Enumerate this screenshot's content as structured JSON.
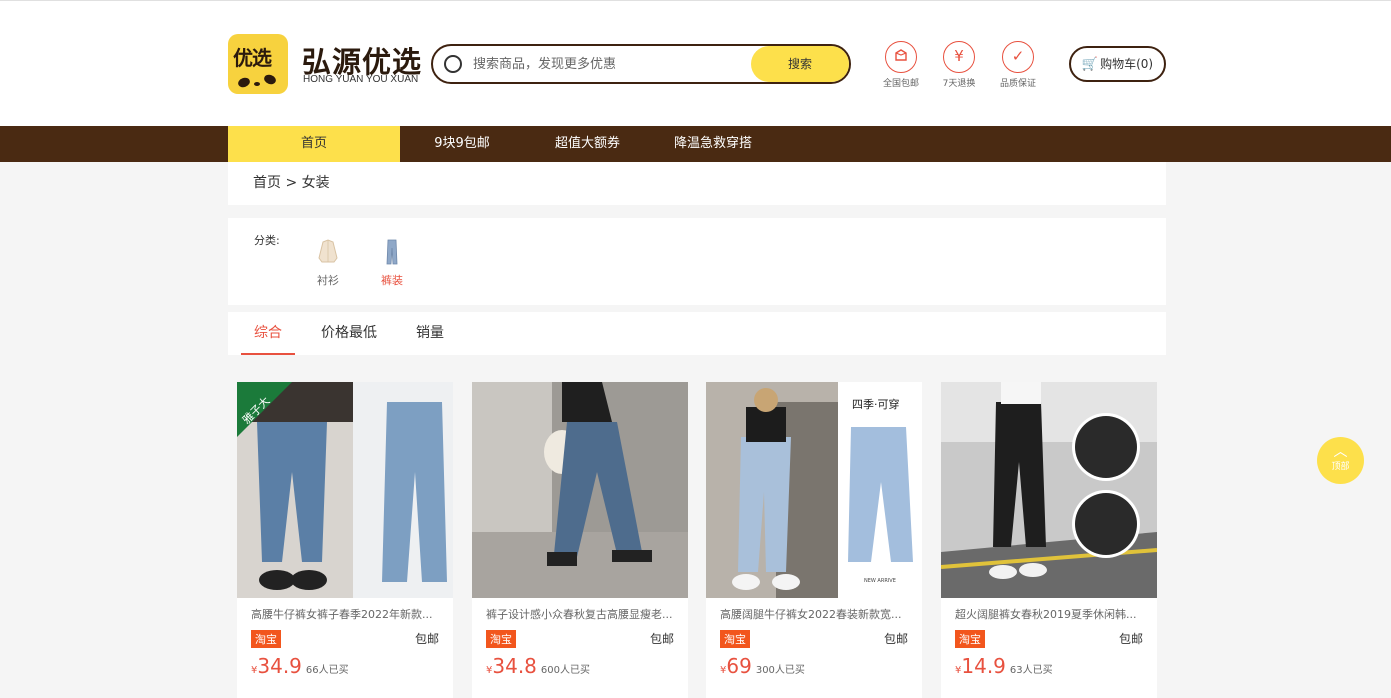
{
  "header": {
    "logo_text": "优选",
    "brand_cn": "弘源优选",
    "brand_en": "HONG YUAN YOU XUAN",
    "search_placeholder": "搜索商品，发现更多优惠",
    "search_button": "搜索",
    "features": [
      {
        "label": "全国包邮",
        "icon": "package-icon"
      },
      {
        "label": "7天退换",
        "icon": "yen-refund-icon"
      },
      {
        "label": "品质保证",
        "icon": "check-icon"
      }
    ],
    "cart_label": "购物车(0)"
  },
  "nav": {
    "items": [
      "首页",
      "9块9包邮",
      "超值大额券",
      "降温急救穿搭"
    ],
    "active_index": 0
  },
  "breadcrumb": "首页 > 女装",
  "category": {
    "label": "分类:",
    "items": [
      {
        "name": "衬衫",
        "selected": false
      },
      {
        "name": "裤装",
        "selected": true
      }
    ]
  },
  "sort": {
    "tabs": [
      "综合",
      "价格最低",
      "销量"
    ],
    "active_index": 0
  },
  "products": [
    {
      "title": "高腰牛仔裤女裤子春季2022年新款...",
      "platform": "淘宝",
      "shipping": "包邮",
      "currency": "¥",
      "price": "34.9",
      "sold": "66人已买"
    },
    {
      "title": "裤子设计感小众春秋复古高腰显瘦老...",
      "platform": "淘宝",
      "shipping": "包邮",
      "currency": "¥",
      "price": "34.8",
      "sold": "600人已买"
    },
    {
      "title": "高腰阔腿牛仔裤女2022春装新款宽...",
      "platform": "淘宝",
      "shipping": "包邮",
      "currency": "¥",
      "price": "69",
      "sold": "300人已买"
    },
    {
      "title": "超火阔腿裤女春秋2019夏季休闲韩...",
      "platform": "淘宝",
      "shipping": "包邮",
      "currency": "¥",
      "price": "14.9",
      "sold": "63人已买"
    }
  ],
  "product_badges": {
    "p1_corner": "雅子大",
    "p3_banner": "四季·可穿",
    "p3_banner_sub": "NEW ARRIVE"
  },
  "to_top": {
    "label": "顶部"
  },
  "colors": {
    "brand_yellow": "#fde04b",
    "brand_brown": "#4a2a12",
    "accent_red": "#e8513f",
    "taobao_orange": "#f2561d"
  }
}
